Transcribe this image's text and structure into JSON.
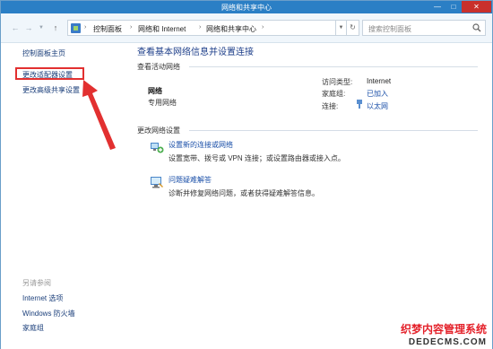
{
  "window": {
    "title": "网络和共享中心",
    "controls": {
      "minimize": "—",
      "maximize": "□",
      "close": "✕"
    }
  },
  "address_bar": {
    "back": "←",
    "forward": "→",
    "up": "↑",
    "breadcrumbs": [
      "控制面板",
      "网络和 Internet",
      "网络和共享中心"
    ],
    "search_placeholder": "搜索控制面板"
  },
  "left_pane": {
    "links": [
      "控制面板主页",
      "更改适配器设置",
      "更改高级共享设置"
    ],
    "see_also_header": "另请参阅",
    "see_also": [
      "Internet 选项",
      "Windows 防火墙",
      "家庭组"
    ]
  },
  "main": {
    "title": "查看基本网络信息并设置连接",
    "active_networks_header": "查看活动网络",
    "network": {
      "name": "网络",
      "type": "专用网络",
      "access_type_label": "访问类型:",
      "access_type_value": "Internet",
      "homegroup_label": "家庭组:",
      "homegroup_value": "已加入",
      "connection_label": "连接:",
      "connection_value": "以太网"
    },
    "change_settings_header": "更改网络设置",
    "tasks": [
      {
        "link": "设置新的连接或网络",
        "description": "设置宽带、拨号或 VPN 连接；或设置路由器或接入点。"
      },
      {
        "link": "问题疑难解答",
        "description": "诊断并修复网络问题，或者获得疑难解答信息。"
      }
    ]
  },
  "watermark": {
    "line1": "织梦内容管理系统",
    "line2": "DEDECMS.COM"
  },
  "colors": {
    "titlebar": "#2b7fc5",
    "link": "#1a4fa8",
    "highlight_box": "#e23030"
  }
}
